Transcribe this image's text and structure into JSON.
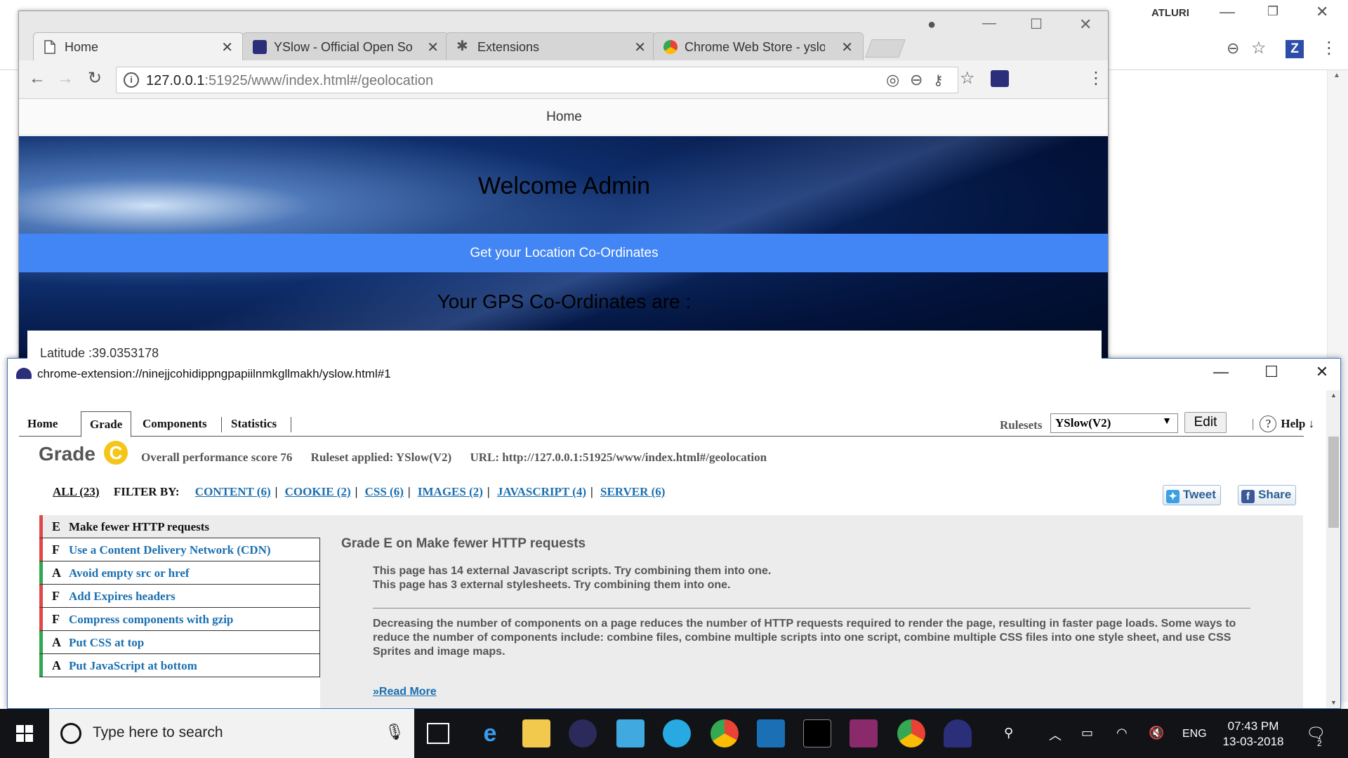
{
  "background_window": {
    "user_name": "ATLURI",
    "extension_badge": "Z"
  },
  "chrome": {
    "tabs": [
      {
        "title": "Home",
        "close": "✕"
      },
      {
        "title": "YSlow - Official Open So",
        "close": "✕"
      },
      {
        "title": "Extensions",
        "close": "✕"
      },
      {
        "title": "Chrome Web Store - yslo",
        "close": "✕"
      }
    ],
    "url_host": "127.0.0.1",
    "url_rest": ":51925/www/index.html#/geolocation"
  },
  "page": {
    "nav_title": "Home",
    "welcome": "Welcome Admin",
    "coord_button": "Get your Location Co-Ordinates",
    "gps_title": "Your GPS Co-Ordinates are :",
    "latitude": "Latitude :39.0353178"
  },
  "yslow": {
    "window_title": "chrome-extension://ninejjcohidippngpapiilnmkgllmakh/yslow.html#1",
    "tabs": [
      "Home",
      "Grade",
      "Components",
      "Statistics"
    ],
    "rulesets_label": "Rulesets",
    "ruleset_selected": "YSlow(V2)",
    "edit_label": "Edit",
    "help_label": "Help",
    "help_arrow": "↓",
    "grade_label": "Grade",
    "grade_value": "C",
    "score_text": "Overall performance score 76",
    "ruleset_applied": "Ruleset applied: YSlow(V2)",
    "url_text": "URL: http://127.0.0.1:51925/www/index.html#/geolocation",
    "filter_all": "ALL (23)",
    "filter_by": "FILTER BY:",
    "filters": [
      "CONTENT (6)",
      "COOKIE (2)",
      "CSS (6)",
      "IMAGES (2)",
      "JAVASCRIPT (4)",
      "SERVER (6)"
    ],
    "tweet_label": "Tweet",
    "share_label": "Share",
    "rules": [
      {
        "grade": "E",
        "name": "Make fewer HTTP requests",
        "color": "#e04848"
      },
      {
        "grade": "F",
        "name": "Use a Content Delivery Network (CDN)",
        "color": "#e04848"
      },
      {
        "grade": "A",
        "name": "Avoid empty src or href",
        "color": "#2fa84f"
      },
      {
        "grade": "F",
        "name": "Add Expires headers",
        "color": "#e04848"
      },
      {
        "grade": "F",
        "name": "Compress components with gzip",
        "color": "#e04848"
      },
      {
        "grade": "A",
        "name": "Put CSS at top",
        "color": "#2fa84f"
      },
      {
        "grade": "A",
        "name": "Put JavaScript at bottom",
        "color": "#2fa84f"
      }
    ],
    "detail_title": "Grade E on Make fewer HTTP requests",
    "detail_line1": "This page has 14 external Javascript scripts. Try combining them into one.",
    "detail_line2": "This page has 3 external stylesheets. Try combining them into one.",
    "detail_paragraph": "Decreasing the number of components on a page reduces the number of HTTP requests required to render the page, resulting in faster page loads. Some ways to reduce the number of components include: combine files, combine multiple scripts into one script, combine multiple CSS files into one style sheet, and use CSS Sprites and image maps.",
    "read_more": "»Read More"
  },
  "taskbar": {
    "search_placeholder": "Type here to search",
    "language": "ENG",
    "time": "07:43 PM",
    "date": "13-03-2018",
    "notification_count": "2"
  },
  "colors": {
    "accent_blue": "#4285f4",
    "grade_badge": "#f5c518",
    "link_blue": "#1a6fb0"
  }
}
